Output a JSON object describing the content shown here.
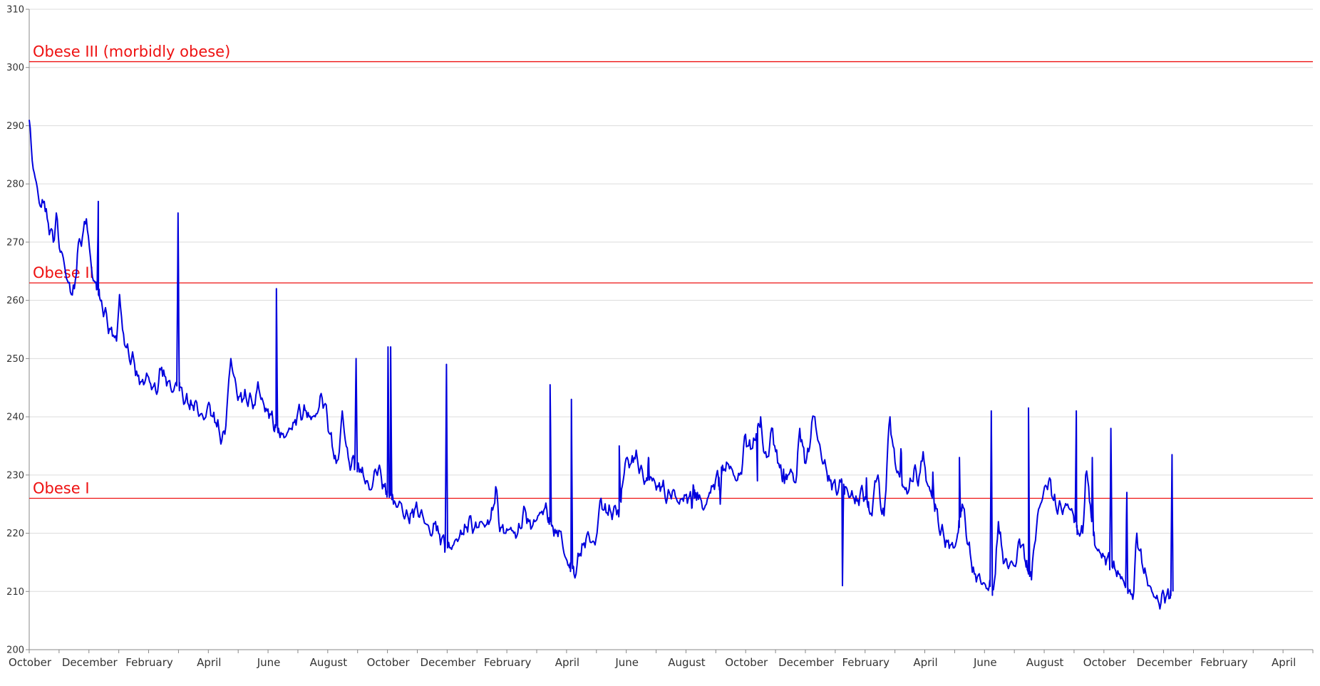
{
  "chart_data": {
    "type": "line",
    "title": "",
    "xlabel": "",
    "ylabel": "",
    "ylim": [
      200,
      310
    ],
    "yticks": [
      200,
      210,
      220,
      230,
      240,
      250,
      260,
      270,
      280,
      290,
      300,
      310
    ],
    "grid": true,
    "legend": "none",
    "x_tick_labels": [
      "October",
      "December",
      "February",
      "April",
      "June",
      "August",
      "October",
      "December",
      "February",
      "April",
      "June",
      "August",
      "October",
      "December",
      "February",
      "April",
      "June",
      "August",
      "October",
      "December",
      "February",
      "April"
    ],
    "x_month_index_range": [
      0,
      43
    ],
    "series_color": "#0000dd",
    "reference_lines": [
      {
        "label": "Obese III (morbidly obese)",
        "value": 301,
        "color": "#ee1111"
      },
      {
        "label": "Obese II",
        "value": 263,
        "color": "#ee1111"
      },
      {
        "label": "Obese I",
        "value": 226,
        "color": "#ee1111"
      }
    ],
    "x_unit": "months since start of axis",
    "x": [
      0.0,
      0.1,
      0.2,
      0.3,
      0.4,
      0.5,
      0.6,
      0.7,
      0.8,
      0.9,
      1.0,
      1.1,
      1.2,
      1.3,
      1.4,
      1.5,
      1.6,
      1.7,
      1.8,
      1.9,
      2.0,
      2.1,
      2.2,
      2.3,
      2.4,
      2.5,
      2.6,
      2.7,
      2.8,
      2.9,
      3.0,
      3.1,
      3.2,
      3.3,
      3.4,
      3.5,
      3.6,
      3.7,
      3.8,
      3.9,
      4.0,
      4.1,
      4.2,
      4.3,
      4.4,
      4.5,
      4.6,
      4.7,
      4.8,
      4.9,
      5.0,
      5.1,
      5.2,
      5.3,
      5.4,
      5.5,
      5.6,
      5.7,
      5.8,
      5.9,
      6.0,
      6.1,
      6.2,
      6.3,
      6.4,
      6.5,
      6.6,
      6.7,
      6.8,
      6.9,
      7.0,
      7.1,
      7.2,
      7.3,
      7.4,
      7.5,
      7.6,
      7.7,
      7.8,
      7.9,
      8.0,
      8.1,
      8.2,
      8.3,
      8.4,
      8.5,
      8.6,
      8.7,
      8.8,
      8.9,
      9.0,
      9.1,
      9.2,
      9.3,
      9.4,
      9.5,
      9.6,
      9.7,
      9.8,
      9.9,
      10.0,
      10.1,
      10.2,
      10.3,
      10.4,
      10.5,
      10.6,
      10.7,
      10.8,
      10.9,
      11.0,
      11.1,
      11.2,
      11.3,
      11.4,
      11.5,
      11.6,
      11.7,
      11.8,
      11.9,
      12.0,
      12.1,
      12.2,
      12.3,
      12.4,
      12.5,
      12.6,
      12.7,
      12.8,
      12.9,
      13.0,
      13.1,
      13.2,
      13.3,
      13.4,
      13.5,
      13.6,
      13.7,
      13.8,
      13.9,
      14.0,
      14.1,
      14.2,
      14.3,
      14.4,
      14.5,
      14.6,
      14.7,
      14.8,
      14.9,
      15.0,
      15.1,
      15.2,
      15.3,
      15.4,
      15.5,
      15.6,
      15.7,
      15.8,
      15.9,
      16.0,
      16.1,
      16.2,
      16.3,
      16.4,
      16.5,
      16.6,
      16.7,
      16.8,
      16.9,
      17.0,
      17.1,
      17.2,
      17.3,
      17.4,
      17.5,
      17.6,
      17.7,
      17.8,
      17.9,
      18.0,
      18.1,
      18.2,
      18.3,
      18.4,
      18.5,
      18.6,
      18.7,
      18.8,
      18.9,
      19.0,
      19.1,
      19.2,
      19.3,
      19.4,
      19.5,
      19.6,
      19.7,
      19.8,
      19.9,
      20.0,
      20.1,
      20.2,
      20.3,
      20.4,
      20.5,
      20.6,
      20.7,
      20.8,
      20.9,
      21.0,
      21.1,
      21.2,
      21.3,
      21.4,
      21.5,
      21.6,
      21.7,
      21.8,
      21.9,
      22.0,
      22.1,
      22.2,
      22.3,
      22.4,
      22.5,
      22.6,
      22.7,
      22.8,
      22.9,
      23.0,
      23.1,
      23.2,
      23.3,
      23.4,
      23.5,
      23.6,
      23.7,
      23.8,
      23.9,
      24.0,
      24.1,
      24.2,
      24.3,
      24.4,
      24.5,
      24.6,
      24.7,
      24.8,
      24.9,
      25.0,
      25.1,
      25.2,
      25.3,
      25.4,
      25.5,
      25.6,
      25.7,
      25.8,
      25.9,
      26.0,
      26.1,
      26.2,
      26.3,
      26.4,
      26.5,
      26.6,
      26.7,
      26.8,
      26.9,
      27.0,
      27.1,
      27.2,
      27.3,
      27.4,
      27.5,
      27.6,
      27.7,
      27.8,
      27.9,
      28.0,
      28.1,
      28.2,
      28.3,
      28.4,
      28.5,
      28.6,
      28.7,
      28.8,
      28.9,
      29.0,
      29.1,
      29.2,
      29.3,
      29.4,
      29.5,
      29.6,
      29.7,
      29.8,
      29.9,
      30.0,
      30.1,
      30.2,
      30.3,
      30.4,
      30.5,
      30.6,
      30.7,
      30.8,
      30.9,
      31.0,
      31.1,
      31.2,
      31.3,
      31.4,
      31.5,
      31.6,
      31.7,
      31.8,
      31.9,
      32.0,
      32.1,
      32.2,
      32.3,
      32.4,
      32.5,
      32.6,
      32.7,
      32.8,
      32.9,
      33.0,
      33.1,
      33.2,
      33.3,
      33.4,
      33.5,
      33.6,
      33.7,
      33.8,
      33.9,
      34.0,
      34.1,
      34.2,
      34.3,
      34.4,
      34.5,
      34.6,
      34.7,
      34.8,
      34.9,
      35.0,
      35.1,
      35.2,
      35.3,
      35.4,
      35.5,
      35.6,
      35.7,
      35.8,
      35.9,
      36.0,
      36.1,
      36.2,
      36.3,
      36.4,
      36.5,
      36.6,
      36.7,
      36.8,
      36.9,
      37.0,
      37.1,
      37.2,
      37.3,
      37.4,
      37.5,
      37.6,
      37.7,
      37.8,
      37.9,
      38.0,
      38.1,
      38.2,
      38.3,
      38.4,
      38.5,
      38.6,
      38.7,
      38.8,
      38.9,
      39.0,
      39.1,
      39.2,
      39.3,
      39.4,
      39.5,
      39.6,
      39.7,
      39.8,
      39.9,
      40.0,
      40.1,
      40.2,
      40.3,
      40.4,
      40.5,
      40.6,
      40.7,
      40.8,
      40.9,
      41.0,
      41.1,
      41.2,
      41.3,
      41.4,
      41.5,
      41.6,
      41.7,
      41.8,
      41.9,
      42.0,
      42.1,
      42.2,
      42.3,
      42.4,
      42.5
    ],
    "y": [
      291.0,
      284.0,
      281.0,
      278.0,
      276.0,
      277.0,
      274.0,
      272.0,
      270.0,
      275.0,
      269.0,
      268.0,
      265.0,
      263.0,
      261.0,
      262.0,
      268.0,
      270.0,
      272.0,
      274.0,
      269.0,
      264.0,
      263.0,
      261.0,
      260.0,
      258.0,
      256.0,
      255.0,
      254.0,
      253.0,
      261.0,
      255.0,
      252.0,
      251.0,
      250.0,
      249.0,
      247.0,
      246.0,
      245.5,
      247.5,
      246.0,
      245.0,
      244.5,
      246.0,
      248.5,
      247.0,
      246.0,
      245.0,
      244.5,
      246.0,
      245.0,
      243.5,
      243.0,
      242.0,
      242.0,
      242.5,
      241.0,
      240.5,
      239.5,
      241.0,
      242.0,
      240.0,
      239.0,
      238.0,
      236.0,
      237.0,
      244.0,
      250.0,
      247.0,
      244.0,
      243.5,
      243.0,
      243.5,
      243.0,
      242.5,
      242.0,
      246.0,
      243.0,
      242.0,
      241.0,
      240.5,
      239.0,
      238.5,
      237.5,
      237.0,
      236.5,
      237.5,
      238.0,
      239.0,
      240.0,
      241.0,
      240.5,
      241.0,
      240.0,
      240.0,
      240.0,
      241.0,
      244.0,
      242.0,
      240.0,
      237.0,
      234.0,
      232.0,
      234.0,
      241.0,
      236.0,
      233.0,
      231.5,
      232.5,
      231.0,
      231.0,
      230.0,
      229.0,
      227.5,
      228.0,
      231.0,
      231.0,
      229.5,
      228.0,
      227.0,
      226.5,
      225.0,
      224.5,
      225.5,
      224.0,
      223.0,
      222.5,
      223.5,
      224.0,
      224.0,
      223.5,
      222.5,
      221.5,
      220.5,
      220.0,
      222.0,
      220.0,
      219.0,
      218.0,
      217.5,
      217.5,
      218.0,
      219.0,
      219.5,
      220.0,
      221.0,
      222.0,
      221.5,
      221.0,
      221.0,
      222.0,
      221.5,
      221.5,
      222.0,
      224.0,
      228.0,
      222.0,
      221.0,
      220.0,
      220.5,
      221.0,
      220.0,
      219.5,
      221.0,
      223.0,
      223.5,
      222.0,
      221.0,
      222.0,
      223.0,
      223.5,
      224.0,
      224.0,
      222.0,
      221.0,
      220.0,
      220.5,
      219.0,
      216.0,
      214.5,
      215.0,
      213.0,
      214.5,
      216.5,
      218.0,
      219.0,
      219.5,
      218.5,
      218.0,
      222.0,
      226.0,
      224.0,
      223.5,
      224.0,
      223.5,
      224.0,
      224.0,
      228.0,
      232.0,
      232.5,
      232.0,
      233.0,
      233.0,
      231.0,
      229.5,
      229.0,
      229.5,
      229.0,
      228.5,
      228.0,
      228.0,
      227.5,
      226.0,
      226.5,
      227.5,
      226.0,
      225.0,
      226.0,
      226.5,
      226.0,
      225.5,
      226.0,
      227.0,
      226.0,
      224.0,
      225.0,
      227.0,
      228.0,
      229.0,
      229.5,
      230.0,
      231.0,
      232.0,
      231.5,
      230.0,
      229.0,
      230.0,
      232.0,
      237.0,
      235.0,
      234.5,
      236.0,
      238.0,
      240.0,
      234.0,
      233.0,
      235.0,
      238.0,
      234.0,
      232.0,
      230.0,
      229.0,
      230.0,
      231.0,
      229.0,
      230.0,
      238.0,
      235.0,
      232.0,
      234.0,
      239.0,
      240.0,
      236.0,
      234.0,
      232.0,
      230.5,
      229.0,
      228.5,
      227.5,
      228.0,
      229.0,
      228.0,
      227.0,
      226.5,
      226.0,
      225.5,
      226.5,
      227.0,
      226.0,
      224.0,
      223.0,
      229.0,
      230.0,
      224.0,
      223.0,
      232.0,
      240.0,
      235.0,
      231.0,
      230.0,
      228.5,
      227.5,
      227.0,
      229.0,
      231.0,
      229.0,
      230.5,
      234.0,
      229.0,
      228.0,
      226.0,
      225.0,
      222.0,
      220.5,
      219.0,
      218.5,
      218.0,
      217.5,
      218.5,
      221.0,
      225.0,
      222.0,
      218.0,
      215.0,
      213.0,
      212.5,
      212.0,
      211.5,
      210.5,
      211.0,
      210.5,
      213.0,
      222.0,
      218.0,
      215.0,
      214.5,
      215.0,
      214.5,
      215.0,
      219.0,
      218.0,
      215.0,
      213.0,
      212.0,
      218.0,
      223.0,
      225.0,
      227.0,
      228.0,
      229.5,
      226.0,
      225.0,
      224.5,
      224.0,
      224.5,
      225.0,
      224.0,
      223.0,
      221.0,
      219.5,
      220.0,
      230.0,
      228.0,
      222.0,
      218.0,
      217.0,
      216.5,
      216.0,
      215.5,
      215.0,
      214.0,
      213.5,
      213.0,
      212.5,
      211.0,
      210.0,
      209.5,
      210.0,
      220.0,
      217.0,
      214.0,
      213.0,
      211.0,
      210.0,
      209.0,
      208.5,
      208.0,
      209.5,
      209.5,
      209.0,
      210.0
    ],
    "spikes": [
      [
        2.6,
        277.0
      ],
      [
        5.6,
        275.0
      ],
      [
        9.3,
        262.0
      ],
      [
        12.3,
        250.0
      ],
      [
        13.5,
        252.0
      ],
      [
        13.6,
        252.0
      ],
      [
        15.7,
        249.0
      ],
      [
        19.6,
        245.5
      ],
      [
        20.4,
        243.0
      ],
      [
        22.2,
        235.0
      ],
      [
        23.3,
        233.0
      ],
      [
        25.0,
        228.0
      ],
      [
        26.0,
        225.0
      ],
      [
        27.4,
        229.0
      ],
      [
        28.4,
        229.5
      ],
      [
        30.6,
        211.0
      ],
      [
        31.5,
        229.5
      ],
      [
        32.8,
        234.5
      ],
      [
        34.0,
        230.5
      ],
      [
        35.0,
        233.0
      ],
      [
        36.2,
        241.0
      ],
      [
        37.6,
        241.5
      ],
      [
        39.4,
        241.0
      ],
      [
        40.7,
        238.0
      ],
      [
        40.0,
        233.0
      ],
      [
        41.3,
        227.0
      ],
      [
        43.0,
        233.5
      ],
      [
        43.2,
        214.0
      ],
      [
        44.3,
        222.5
      ],
      [
        44.9,
        232.5
      ],
      [
        46.5,
        234.0
      ],
      [
        47.1,
        224.0
      ],
      [
        47.9,
        208.0
      ]
    ]
  }
}
